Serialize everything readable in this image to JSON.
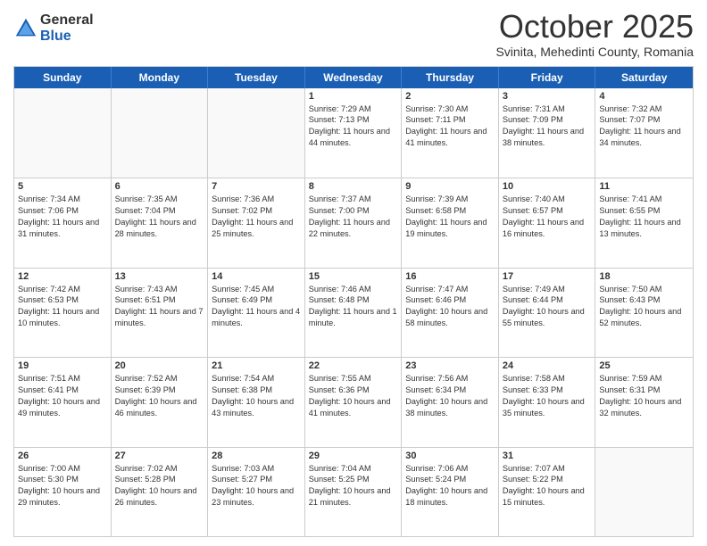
{
  "header": {
    "logo_general": "General",
    "logo_blue": "Blue",
    "month": "October 2025",
    "location": "Svinita, Mehedinti County, Romania"
  },
  "weekdays": [
    "Sunday",
    "Monday",
    "Tuesday",
    "Wednesday",
    "Thursday",
    "Friday",
    "Saturday"
  ],
  "weeks": [
    [
      {
        "day": "",
        "sunrise": "",
        "sunset": "",
        "daylight": "",
        "empty": true
      },
      {
        "day": "",
        "sunrise": "",
        "sunset": "",
        "daylight": "",
        "empty": true
      },
      {
        "day": "",
        "sunrise": "",
        "sunset": "",
        "daylight": "",
        "empty": true
      },
      {
        "day": "1",
        "sunrise": "Sunrise: 7:29 AM",
        "sunset": "Sunset: 7:13 PM",
        "daylight": "Daylight: 11 hours and 44 minutes."
      },
      {
        "day": "2",
        "sunrise": "Sunrise: 7:30 AM",
        "sunset": "Sunset: 7:11 PM",
        "daylight": "Daylight: 11 hours and 41 minutes."
      },
      {
        "day": "3",
        "sunrise": "Sunrise: 7:31 AM",
        "sunset": "Sunset: 7:09 PM",
        "daylight": "Daylight: 11 hours and 38 minutes."
      },
      {
        "day": "4",
        "sunrise": "Sunrise: 7:32 AM",
        "sunset": "Sunset: 7:07 PM",
        "daylight": "Daylight: 11 hours and 34 minutes."
      }
    ],
    [
      {
        "day": "5",
        "sunrise": "Sunrise: 7:34 AM",
        "sunset": "Sunset: 7:06 PM",
        "daylight": "Daylight: 11 hours and 31 minutes."
      },
      {
        "day": "6",
        "sunrise": "Sunrise: 7:35 AM",
        "sunset": "Sunset: 7:04 PM",
        "daylight": "Daylight: 11 hours and 28 minutes."
      },
      {
        "day": "7",
        "sunrise": "Sunrise: 7:36 AM",
        "sunset": "Sunset: 7:02 PM",
        "daylight": "Daylight: 11 hours and 25 minutes."
      },
      {
        "day": "8",
        "sunrise": "Sunrise: 7:37 AM",
        "sunset": "Sunset: 7:00 PM",
        "daylight": "Daylight: 11 hours and 22 minutes."
      },
      {
        "day": "9",
        "sunrise": "Sunrise: 7:39 AM",
        "sunset": "Sunset: 6:58 PM",
        "daylight": "Daylight: 11 hours and 19 minutes."
      },
      {
        "day": "10",
        "sunrise": "Sunrise: 7:40 AM",
        "sunset": "Sunset: 6:57 PM",
        "daylight": "Daylight: 11 hours and 16 minutes."
      },
      {
        "day": "11",
        "sunrise": "Sunrise: 7:41 AM",
        "sunset": "Sunset: 6:55 PM",
        "daylight": "Daylight: 11 hours and 13 minutes."
      }
    ],
    [
      {
        "day": "12",
        "sunrise": "Sunrise: 7:42 AM",
        "sunset": "Sunset: 6:53 PM",
        "daylight": "Daylight: 11 hours and 10 minutes."
      },
      {
        "day": "13",
        "sunrise": "Sunrise: 7:43 AM",
        "sunset": "Sunset: 6:51 PM",
        "daylight": "Daylight: 11 hours and 7 minutes."
      },
      {
        "day": "14",
        "sunrise": "Sunrise: 7:45 AM",
        "sunset": "Sunset: 6:49 PM",
        "daylight": "Daylight: 11 hours and 4 minutes."
      },
      {
        "day": "15",
        "sunrise": "Sunrise: 7:46 AM",
        "sunset": "Sunset: 6:48 PM",
        "daylight": "Daylight: 11 hours and 1 minute."
      },
      {
        "day": "16",
        "sunrise": "Sunrise: 7:47 AM",
        "sunset": "Sunset: 6:46 PM",
        "daylight": "Daylight: 10 hours and 58 minutes."
      },
      {
        "day": "17",
        "sunrise": "Sunrise: 7:49 AM",
        "sunset": "Sunset: 6:44 PM",
        "daylight": "Daylight: 10 hours and 55 minutes."
      },
      {
        "day": "18",
        "sunrise": "Sunrise: 7:50 AM",
        "sunset": "Sunset: 6:43 PM",
        "daylight": "Daylight: 10 hours and 52 minutes."
      }
    ],
    [
      {
        "day": "19",
        "sunrise": "Sunrise: 7:51 AM",
        "sunset": "Sunset: 6:41 PM",
        "daylight": "Daylight: 10 hours and 49 minutes."
      },
      {
        "day": "20",
        "sunrise": "Sunrise: 7:52 AM",
        "sunset": "Sunset: 6:39 PM",
        "daylight": "Daylight: 10 hours and 46 minutes."
      },
      {
        "day": "21",
        "sunrise": "Sunrise: 7:54 AM",
        "sunset": "Sunset: 6:38 PM",
        "daylight": "Daylight: 10 hours and 43 minutes."
      },
      {
        "day": "22",
        "sunrise": "Sunrise: 7:55 AM",
        "sunset": "Sunset: 6:36 PM",
        "daylight": "Daylight: 10 hours and 41 minutes."
      },
      {
        "day": "23",
        "sunrise": "Sunrise: 7:56 AM",
        "sunset": "Sunset: 6:34 PM",
        "daylight": "Daylight: 10 hours and 38 minutes."
      },
      {
        "day": "24",
        "sunrise": "Sunrise: 7:58 AM",
        "sunset": "Sunset: 6:33 PM",
        "daylight": "Daylight: 10 hours and 35 minutes."
      },
      {
        "day": "25",
        "sunrise": "Sunrise: 7:59 AM",
        "sunset": "Sunset: 6:31 PM",
        "daylight": "Daylight: 10 hours and 32 minutes."
      }
    ],
    [
      {
        "day": "26",
        "sunrise": "Sunrise: 7:00 AM",
        "sunset": "Sunset: 5:30 PM",
        "daylight": "Daylight: 10 hours and 29 minutes."
      },
      {
        "day": "27",
        "sunrise": "Sunrise: 7:02 AM",
        "sunset": "Sunset: 5:28 PM",
        "daylight": "Daylight: 10 hours and 26 minutes."
      },
      {
        "day": "28",
        "sunrise": "Sunrise: 7:03 AM",
        "sunset": "Sunset: 5:27 PM",
        "daylight": "Daylight: 10 hours and 23 minutes."
      },
      {
        "day": "29",
        "sunrise": "Sunrise: 7:04 AM",
        "sunset": "Sunset: 5:25 PM",
        "daylight": "Daylight: 10 hours and 21 minutes."
      },
      {
        "day": "30",
        "sunrise": "Sunrise: 7:06 AM",
        "sunset": "Sunset: 5:24 PM",
        "daylight": "Daylight: 10 hours and 18 minutes."
      },
      {
        "day": "31",
        "sunrise": "Sunrise: 7:07 AM",
        "sunset": "Sunset: 5:22 PM",
        "daylight": "Daylight: 10 hours and 15 minutes."
      },
      {
        "day": "",
        "sunrise": "",
        "sunset": "",
        "daylight": "",
        "empty": true
      }
    ]
  ]
}
